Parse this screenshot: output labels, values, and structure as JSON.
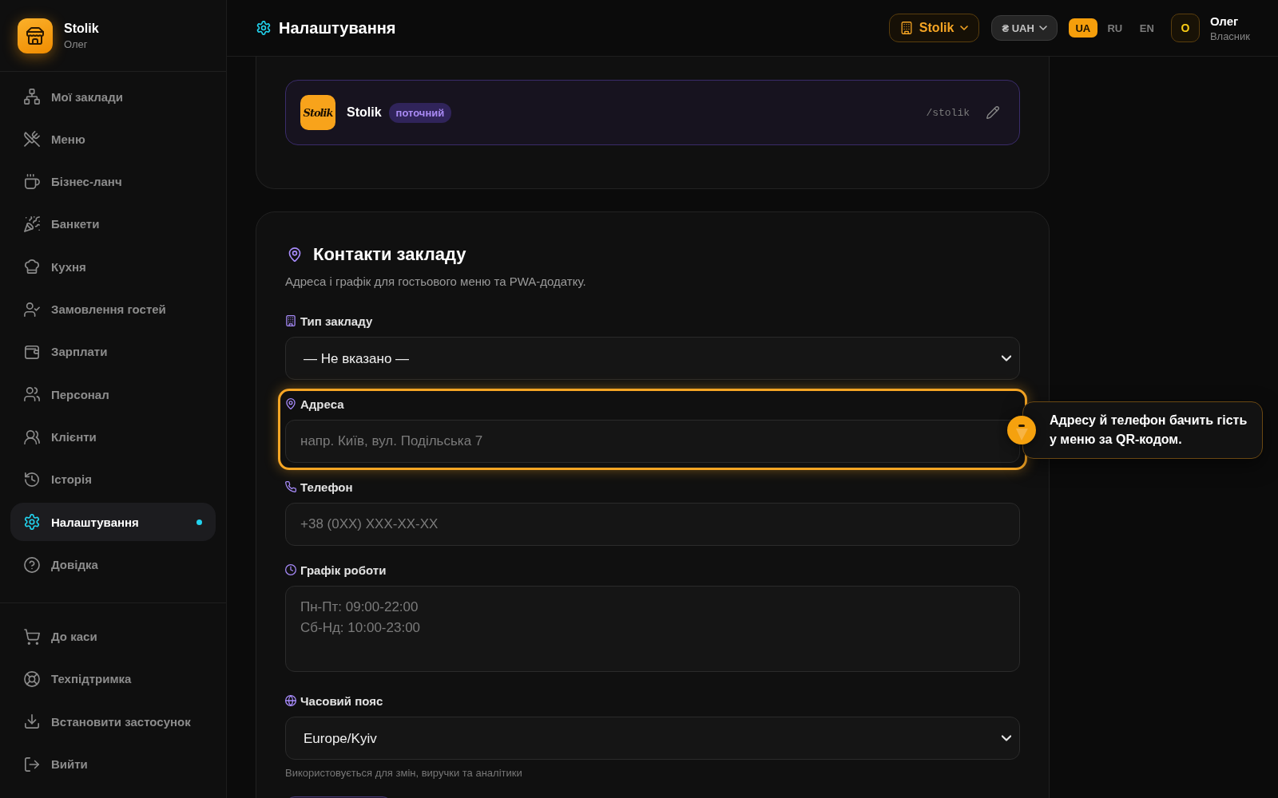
{
  "sidebar": {
    "brand": {
      "name": "Stolik",
      "subtitle": "Олег"
    },
    "items": [
      {
        "label": "Мої заклади",
        "selected": false
      },
      {
        "label": "Меню",
        "selected": false
      },
      {
        "label": "Бізнес-ланч",
        "selected": false
      },
      {
        "label": "Банкети",
        "selected": false
      },
      {
        "label": "Кухня",
        "selected": false
      },
      {
        "label": "Замовлення гостей",
        "selected": false
      },
      {
        "label": "Зарплати",
        "selected": false
      },
      {
        "label": "Персонал",
        "selected": false
      },
      {
        "label": "Клієнти",
        "selected": false
      },
      {
        "label": "Історія",
        "selected": false
      },
      {
        "label": "Налаштування",
        "selected": true
      },
      {
        "label": "Довідка",
        "selected": false
      }
    ],
    "footer_items": [
      {
        "label": "До каси",
        "selected": false
      },
      {
        "label": "Техпідтримка",
        "selected": false
      },
      {
        "label": "Встановити застосунок",
        "selected": false
      },
      {
        "label": "Вийти",
        "selected": false
      }
    ]
  },
  "header": {
    "title": "Налаштування",
    "venue_button": "Stolik",
    "currency_button": "₴ UAH",
    "languages": [
      {
        "label": "UA",
        "selected": true
      },
      {
        "label": "RU",
        "selected": false
      },
      {
        "label": "EN",
        "selected": false
      }
    ],
    "user": {
      "avatar": "О",
      "name": "Олег",
      "role": "Власник"
    }
  },
  "venues": [
    {
      "logo": "Stolik",
      "name": "Stolik",
      "badge": "поточний",
      "slug": "/stolik"
    }
  ],
  "contacts": {
    "title": "Контакти закладу",
    "subtitle": "Адреса і графік для гостьового меню та PWA-додатку.",
    "fields": [
      {
        "kind": "select",
        "label": "Тип закладу",
        "value": "— Не вказано —",
        "highlighted": false
      },
      {
        "kind": "input",
        "label": "Адреса",
        "placeholder": "напр. Київ, вул. Подільська 7",
        "highlighted": true
      },
      {
        "kind": "input",
        "label": "Телефон",
        "placeholder": "+38 (0XX) XXX-XX-XX",
        "highlighted": false
      },
      {
        "kind": "textarea",
        "label": "Графік роботи",
        "placeholder": "Пн-Пт: 09:00-22:00\nСб-Нд: 10:00-23:00",
        "highlighted": false
      },
      {
        "kind": "select",
        "label": "Часовий пояс",
        "value": "Europe/Kyiv",
        "hint": "Використовується для змін, виручки та аналітики",
        "highlighted": false
      }
    ]
  },
  "tooltip": {
    "text": "Адресу й телефон бачить гість у меню за QR-кодом."
  }
}
